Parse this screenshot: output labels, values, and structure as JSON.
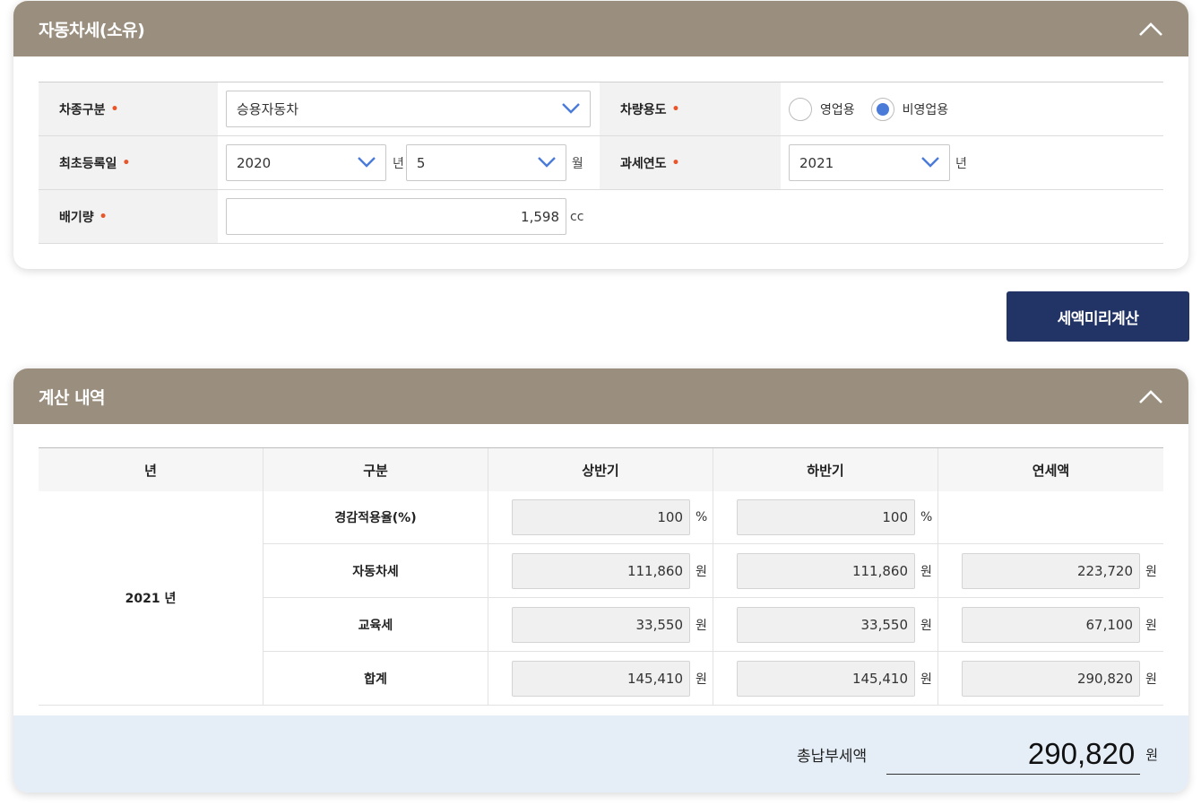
{
  "vehicle_panel": {
    "title": "자동차세(소유)",
    "vehicle_type": {
      "label": "차종구분",
      "value": "승용자동차"
    },
    "vehicle_use": {
      "label": "차량용도",
      "options": [
        "영업용",
        "비영업용"
      ],
      "selected": "비영업용"
    },
    "first_registration": {
      "label": "최초등록일",
      "year": "2020",
      "year_unit": "년",
      "month": "5",
      "month_unit": "월"
    },
    "tax_year": {
      "label": "과세연도",
      "value": "2021",
      "unit": "년"
    },
    "displacement": {
      "label": "배기량",
      "value": "1,598",
      "unit": "cc"
    },
    "required_mark": "•"
  },
  "calc_button": {
    "label": "세액미리계산"
  },
  "result_panel": {
    "title": "계산 내역",
    "headers": [
      "년",
      "구분",
      "상반기",
      "하반기",
      "연세액"
    ],
    "year_label": "2021 년",
    "rows": [
      {
        "label": "경감적용율(%)",
        "first": "100",
        "second": "100",
        "annual": "",
        "unit": "%"
      },
      {
        "label": "자동차세",
        "first": "111,860",
        "second": "111,860",
        "annual": "223,720",
        "unit": "원"
      },
      {
        "label": "교육세",
        "first": "33,550",
        "second": "33,550",
        "annual": "67,100",
        "unit": "원"
      },
      {
        "label": "합계",
        "first": "145,410",
        "second": "145,410",
        "annual": "290,820",
        "unit": "원"
      }
    ],
    "total": {
      "label": "총납부세액",
      "value": "290,820",
      "unit": "원"
    }
  },
  "colors": {
    "panel_header": "#9a8f7e",
    "button": "#223466",
    "accent": "#4a7bd8",
    "required": "#e8572b",
    "total_bg": "#e5eef7"
  }
}
